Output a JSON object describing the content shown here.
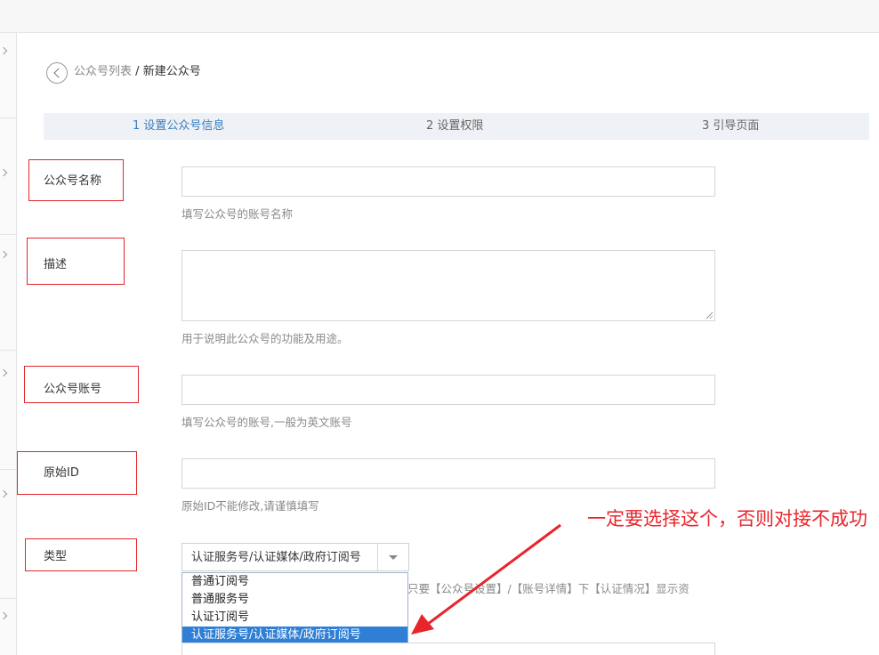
{
  "breadcrumb": {
    "parent": "公众号列表",
    "separator": "/",
    "current": "新建公众号"
  },
  "steps": [
    {
      "label": "1 设置公众号信息",
      "active": true
    },
    {
      "label": "2 设置权限",
      "active": false
    },
    {
      "label": "3 引导页面",
      "active": false
    }
  ],
  "form": {
    "name": {
      "label": "公众号名称",
      "value": "",
      "hint": "填写公众号的账号名称"
    },
    "description": {
      "label": "描述",
      "value": "",
      "hint": "用于说明此公众号的功能及用途。"
    },
    "account": {
      "label": "公众号账号",
      "value": "",
      "hint": "填写公众号的账号,一般为英文账号"
    },
    "original_id": {
      "label": "原始ID",
      "value": "",
      "hint": "原始ID不能修改,请谨慎填写"
    },
    "type": {
      "label": "类型",
      "selected": "认证服务号/认证媒体/政府订阅号",
      "options": [
        "普通订阅号",
        "普通服务号",
        "认证订阅号",
        "认证服务号/认证媒体/政府订阅号"
      ],
      "hint_partial": "只要【公众号设置】/【账号详情】下【认证情况】显示资"
    }
  },
  "annotation": {
    "text": "一定要选择这个，否则对接不成功",
    "color": "#e8252b"
  },
  "colors": {
    "accent": "#3a7fc1",
    "selected_option": "#2f7fd6",
    "highlight_box": "#e0282d"
  }
}
